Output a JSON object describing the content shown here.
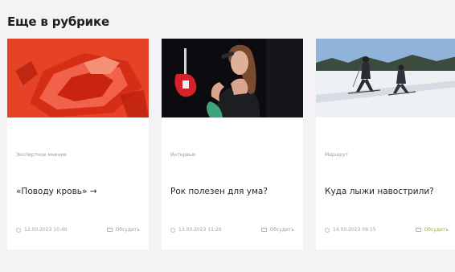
{
  "section": {
    "title": "Еще в рубрике"
  },
  "cards": [
    {
      "image_alt": "red abstract photo",
      "category": "Экспертное мнение",
      "title": "«Поводу кровь» →",
      "date": "12.03.2023 10:40",
      "comments": "Обсудить"
    },
    {
      "image_alt": "singer with microphone and guitar",
      "category": "Интервью",
      "title": "Рок полезен для ума?",
      "date": "13.03.2023 11:20",
      "comments": "Обсудить"
    },
    {
      "image_alt": "skiers on snow",
      "category": "Маршрут",
      "title": "Куда лыжи навострили?",
      "date": "14.03.2023 09:15",
      "comments": "Обсудить"
    }
  ],
  "colors": {
    "page_bg": "#f3f3f5",
    "card_bg": "#ffffff",
    "accent": "#a8a24a"
  }
}
